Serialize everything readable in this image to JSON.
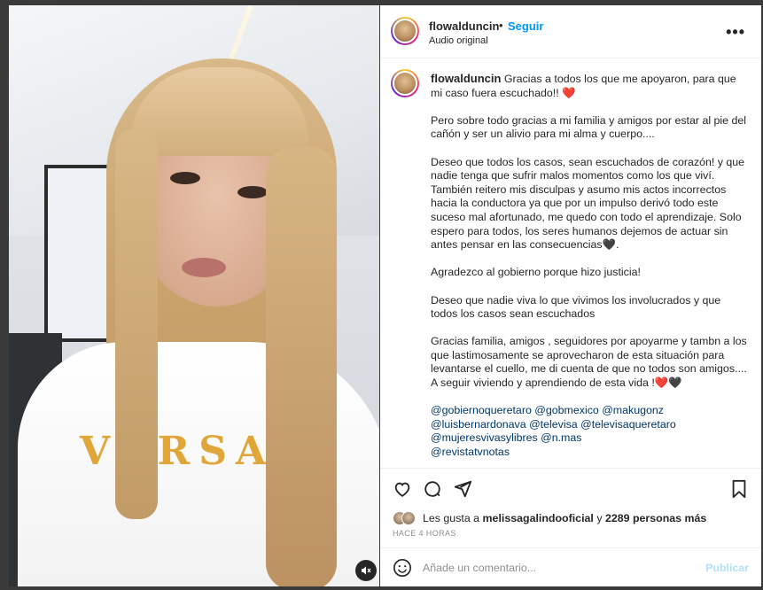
{
  "post": {
    "username": "flowalduncin",
    "follow_label": "Seguir",
    "separator": "•",
    "audio_label": "Audio original"
  },
  "caption": {
    "username": "flowalduncin",
    "paragraphs": [
      "Gracias a todos los que me apoyaron, para que mi caso fuera escuchado!! ❤️",
      "Pero sobre todo gracias a mi familia y amigos por estar al pie del cañón y ser un alivio para mi alma y cuerpo....",
      "Deseo que todos los casos, sean escuchados de corazón! y que nadie tenga que sufrir malos momentos como los que viví.",
      "También reitero mis disculpas y asumo mis actos incorrectos hacia la conductora ya que por un impulso derivó todo este suceso mal afortunado, me quedo con todo el aprendizaje. Solo espero para todos, los seres humanos dejemos de actuar sin antes pensar en las consecuencias🖤.",
      "Agradezco al gobierno porque hizo justicia!",
      "Deseo que nadie viva lo que vivimos los involucrados y que todos los casos sean escuchados",
      "Gracias familia, amigos , seguidores por apoyarme y tambn a los que lastimosamente se aprovecharon de esta situación para levantarse el cuello, me di cuenta de que no todos son amigos.... A seguir viviendo y aprendiendo de esta vida !❤️🖤"
    ],
    "mentions_line1": "@gobiernoqueretaro @gobmexico @makugonz",
    "mentions_line2": "@luisbernardonava @televisa @televisaqueretaro",
    "mentions_line3": "@mujeresvivasylibres @n.mas",
    "mentions_line4": "@revistatvnotas"
  },
  "video": {
    "sweater_text": "VERSA",
    "mute_icon": "speaker-muted-icon"
  },
  "actions": {
    "icons": [
      "heart-icon",
      "comment-icon",
      "share-icon",
      "bookmark-icon"
    ]
  },
  "likes": {
    "prefix": "Les gusta a",
    "user": "melissagalindooficial",
    "connector": "y",
    "others": "2289 personas más",
    "time": "HACE 4 HORAS"
  },
  "comment": {
    "placeholder": "Añade un comentario...",
    "publish_label": "Publicar",
    "emoji_icon": "emoji-icon"
  },
  "colors": {
    "link_blue": "#0095f6",
    "mention_blue": "#00376b",
    "publish_disabled": "#b2dffc",
    "heart_red": "#e0245e"
  }
}
